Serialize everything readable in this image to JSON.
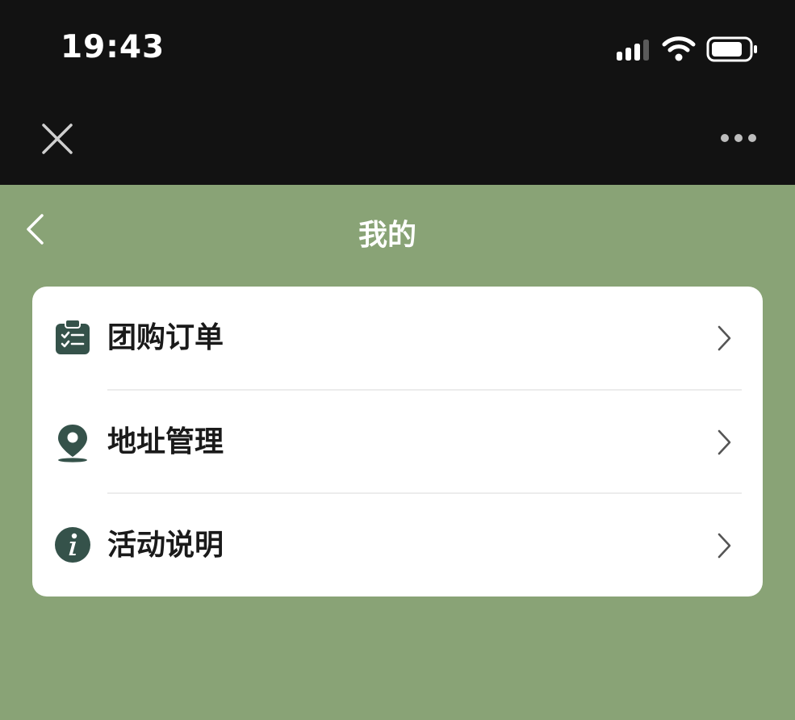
{
  "status_bar": {
    "time": "19:43",
    "icons": [
      "signal-icon",
      "wifi-icon",
      "battery-icon"
    ]
  },
  "capsule_bar": {
    "icons": [
      "close-icon",
      "more-icon"
    ]
  },
  "nav": {
    "title": "我的",
    "back_icon": "chevron-left-icon"
  },
  "menu": {
    "items": [
      {
        "label": "团购订单",
        "icon": "order-clipboard-icon"
      },
      {
        "label": "地址管理",
        "icon": "location-pin-icon"
      },
      {
        "label": "活动说明",
        "icon": "info-icon"
      }
    ]
  },
  "colors": {
    "background": "#89a376",
    "top_bar": "#121212",
    "card": "#ffffff",
    "icon": "#35524a",
    "text": "#1a1a1a"
  }
}
